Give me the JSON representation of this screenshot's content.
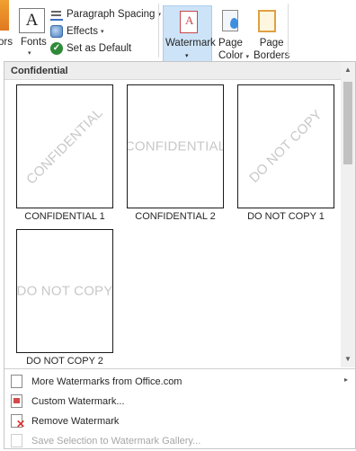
{
  "ribbon": {
    "colors_label": "ors",
    "fonts_glyph": "A",
    "fonts_label": "Fonts",
    "paragraph_spacing_label": "Paragraph Spacing",
    "effects_label": "Effects",
    "set_default_label": "Set as Default",
    "watermark_label": "Watermark",
    "page_color_label_1": "Page",
    "page_color_label_2": "Color",
    "page_borders_label_1": "Page",
    "page_borders_label_2": "Borders",
    "caret": "▾",
    "check": "✓"
  },
  "gallery": {
    "section_header": "Confidential",
    "items": [
      {
        "caption": "CONFIDENTIAL 1",
        "watermark": "CONFIDENTIAL",
        "orientation": "diagonal"
      },
      {
        "caption": "CONFIDENTIAL 2",
        "watermark": "CONFIDENTIAL",
        "orientation": "horizontal"
      },
      {
        "caption": "DO NOT COPY 1",
        "watermark": "DO NOT COPY",
        "orientation": "diagonal"
      },
      {
        "caption": "DO NOT COPY 2",
        "watermark": "DO NOT COPY",
        "orientation": "horizontal"
      }
    ],
    "scroll_up": "▲",
    "scroll_down": "▼"
  },
  "menu": {
    "more_watermarks": "More Watermarks from Office.com",
    "custom_watermark": "Custom Watermark...",
    "remove_watermark": "Remove Watermark",
    "save_selection": "Save Selection to Watermark Gallery...",
    "submenu_arrow": "▸"
  },
  "colors": {
    "selected_button_bg": "#cde3f7",
    "watermark_text": "#c8c8c8",
    "disabled_text": "#a6a6a6"
  }
}
